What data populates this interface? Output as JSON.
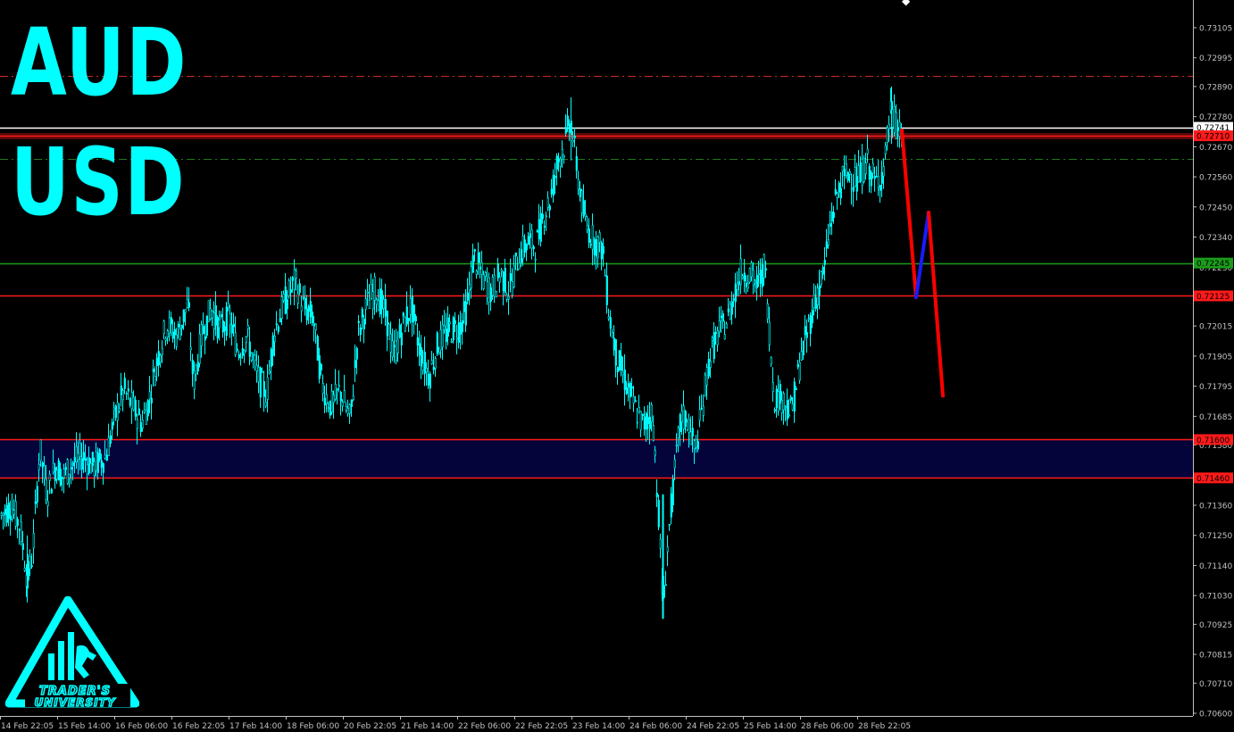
{
  "chart_data": {
    "type": "candlestick",
    "title_lines": [
      "AUD",
      "USD"
    ],
    "y_axis": {
      "range": [
        0.70555,
        0.73185
      ],
      "ticks": [
        "0.73105",
        "0.72995",
        "0.72890",
        "0.72780",
        "0.72670",
        "0.72560",
        "0.72450",
        "0.72340",
        "0.72230",
        "0.72125",
        "0.72015",
        "0.71905",
        "0.71795",
        "0.71685",
        "0.71580",
        "0.71470",
        "0.71360",
        "0.71250",
        "0.71140",
        "0.71030",
        "0.70925",
        "0.70815",
        "0.70710",
        "0.70600"
      ]
    },
    "x_axis": {
      "ticks": [
        "14 Feb 22:05",
        "15 Feb 14:00",
        "16 Feb 06:00",
        "16 Feb 22:05",
        "17 Feb 14:00",
        "18 Feb 06:00",
        "20 Feb 22:05",
        "21 Feb 14:00",
        "22 Feb 06:00",
        "22 Feb 22:05",
        "23 Feb 14:00",
        "24 Feb 06:00",
        "24 Feb 22:05",
        "25 Feb 14:00",
        "28 Feb 06:00",
        "28 Feb 22:05"
      ]
    },
    "price_series": [
      [
        0,
        0.7132
      ],
      [
        12,
        0.7136
      ],
      [
        22,
        0.7128
      ],
      [
        30,
        0.7109
      ],
      [
        36,
        0.7118
      ],
      [
        44,
        0.7157
      ],
      [
        52,
        0.714
      ],
      [
        62,
        0.7151
      ],
      [
        70,
        0.7146
      ],
      [
        80,
        0.7151
      ],
      [
        92,
        0.7154
      ],
      [
        104,
        0.715
      ],
      [
        118,
        0.7154
      ],
      [
        128,
        0.7168
      ],
      [
        138,
        0.7178
      ],
      [
        148,
        0.7172
      ],
      [
        158,
        0.7166
      ],
      [
        166,
        0.7174
      ],
      [
        176,
        0.719
      ],
      [
        186,
        0.7202
      ],
      [
        198,
        0.7198
      ],
      [
        210,
        0.721
      ],
      [
        216,
        0.718
      ],
      [
        226,
        0.7199
      ],
      [
        236,
        0.7208
      ],
      [
        246,
        0.72
      ],
      [
        256,
        0.7205
      ],
      [
        266,
        0.7192
      ],
      [
        276,
        0.7198
      ],
      [
        288,
        0.7183
      ],
      [
        298,
        0.7176
      ],
      [
        306,
        0.7199
      ],
      [
        318,
        0.721
      ],
      [
        330,
        0.7218
      ],
      [
        340,
        0.7208
      ],
      [
        350,
        0.7205
      ],
      [
        360,
        0.718
      ],
      [
        370,
        0.7172
      ],
      [
        380,
        0.7178
      ],
      [
        392,
        0.7167
      ],
      [
        400,
        0.7198
      ],
      [
        410,
        0.7209
      ],
      [
        420,
        0.7215
      ],
      [
        432,
        0.7205
      ],
      [
        440,
        0.719
      ],
      [
        450,
        0.7201
      ],
      [
        460,
        0.7209
      ],
      [
        470,
        0.7192
      ],
      [
        480,
        0.7183
      ],
      [
        490,
        0.7195
      ],
      [
        502,
        0.72
      ],
      [
        514,
        0.7201
      ],
      [
        522,
        0.7208
      ],
      [
        530,
        0.7227
      ],
      [
        540,
        0.7219
      ],
      [
        550,
        0.7214
      ],
      [
        560,
        0.7221
      ],
      [
        570,
        0.7214
      ],
      [
        580,
        0.7227
      ],
      [
        590,
        0.7232
      ],
      [
        600,
        0.7231
      ],
      [
        608,
        0.7242
      ],
      [
        616,
        0.7248
      ],
      [
        624,
        0.7262
      ],
      [
        632,
        0.7268
      ],
      [
        638,
        0.7278
      ],
      [
        646,
        0.7258
      ],
      [
        654,
        0.724
      ],
      [
        664,
        0.7233
      ],
      [
        674,
        0.723
      ],
      [
        682,
        0.7205
      ],
      [
        690,
        0.719
      ],
      [
        700,
        0.7181
      ],
      [
        710,
        0.7172
      ],
      [
        720,
        0.7165
      ],
      [
        730,
        0.717
      ],
      [
        738,
        0.7128
      ],
      [
        742,
        0.7098
      ],
      [
        748,
        0.7125
      ],
      [
        756,
        0.7151
      ],
      [
        762,
        0.7168
      ],
      [
        770,
        0.7167
      ],
      [
        778,
        0.7155
      ],
      [
        786,
        0.7172
      ],
      [
        794,
        0.719
      ],
      [
        804,
        0.7199
      ],
      [
        814,
        0.7203
      ],
      [
        822,
        0.7214
      ],
      [
        830,
        0.7222
      ],
      [
        840,
        0.722
      ],
      [
        848,
        0.7216
      ],
      [
        856,
        0.7224
      ],
      [
        866,
        0.7176
      ],
      [
        876,
        0.7175
      ],
      [
        886,
        0.717
      ],
      [
        896,
        0.7189
      ],
      [
        906,
        0.7203
      ],
      [
        914,
        0.7213
      ],
      [
        922,
        0.7221
      ],
      [
        930,
        0.724
      ],
      [
        940,
        0.7253
      ],
      [
        950,
        0.7258
      ],
      [
        960,
        0.7254
      ],
      [
        970,
        0.7262
      ],
      [
        980,
        0.7253
      ],
      [
        990,
        0.726
      ],
      [
        996,
        0.7279
      ],
      [
        1002,
        0.7276
      ],
      [
        1008,
        0.7272
      ]
    ],
    "horizontal_levels": [
      {
        "price": "0.72741",
        "color": "#ffffff",
        "label_color": "#000000",
        "label_bg": "#ffffff",
        "style": "solid"
      },
      {
        "price": "0.72710",
        "color": "#ff1a1a",
        "label_color": "#000000",
        "label_bg": "#ff1a1a",
        "style": "solid"
      },
      {
        "price": "0.72245",
        "color": "#1a9c1a",
        "label_color": "#000000",
        "label_bg": "#1a9c1a",
        "style": "solid"
      },
      {
        "price": "0.72125",
        "color": "#ff1a1a",
        "label_color": "#000000",
        "label_bg": "#ff1a1a",
        "style": "solid"
      },
      {
        "price": "0.71600",
        "color": "#ff1a1a",
        "label_color": "#000000",
        "label_bg": "#ff1a1a",
        "style": "solid"
      },
      {
        "price": "0.71460",
        "color": "#ff1a1a",
        "label_color": "#000000",
        "label_bg": "#ff1a1a",
        "style": "solid"
      },
      {
        "price": "0.72930",
        "color": "#cc2a2a",
        "style": "dashdot"
      },
      {
        "price": "0.72625",
        "color": "#1f7a1f",
        "style": "dashdot"
      }
    ],
    "zone": {
      "from": "0.71460",
      "to": "0.71600",
      "color": "#04043a"
    },
    "projection": [
      {
        "from": [
          1010,
          0.7273
        ],
        "to": [
          1026,
          0.7212
        ],
        "color": "#ff0000"
      },
      {
        "from": [
          1026,
          0.7212
        ],
        "to": [
          1040,
          0.7243
        ],
        "color": "#1a1aff"
      },
      {
        "from": [
          1040,
          0.7243
        ],
        "to": [
          1056,
          0.7176
        ],
        "color": "#ff0000"
      }
    ],
    "colors": {
      "background": "#000000",
      "candles": "#00ffff",
      "axis": "#c0c0c0",
      "title": "#00ffff"
    }
  },
  "logo": {
    "text_line1": "TRADER'S",
    "text_line2": "UNIVERSITY",
    "color": "#00ffff"
  }
}
